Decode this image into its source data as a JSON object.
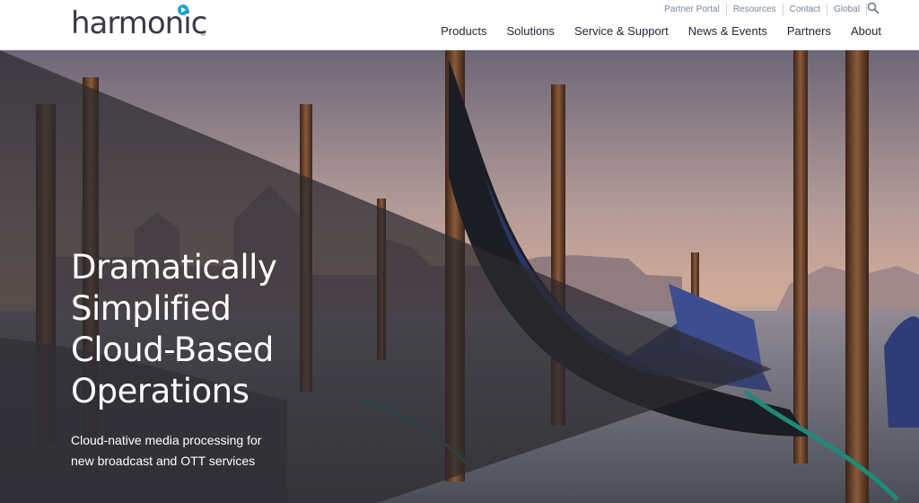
{
  "brand": {
    "name": "harmonic",
    "registered": "®"
  },
  "utility_nav": [
    "Partner Portal",
    "Resources",
    "Contact",
    "Global"
  ],
  "main_nav": [
    "Products",
    "Solutions",
    "Service & Support",
    "News & Events",
    "Partners",
    "About"
  ],
  "hero": {
    "title": "Dramatically\nSimplified\nCloud-Based\nOperations",
    "subtitle": "Cloud-native media processing for new broadcast and OTT services"
  },
  "icons": {
    "search": "search-icon",
    "logo_play": "play-icon"
  },
  "colors": {
    "accent": "#1ba3d9",
    "nav_text": "#1f2530",
    "util_text": "#7a8594"
  }
}
